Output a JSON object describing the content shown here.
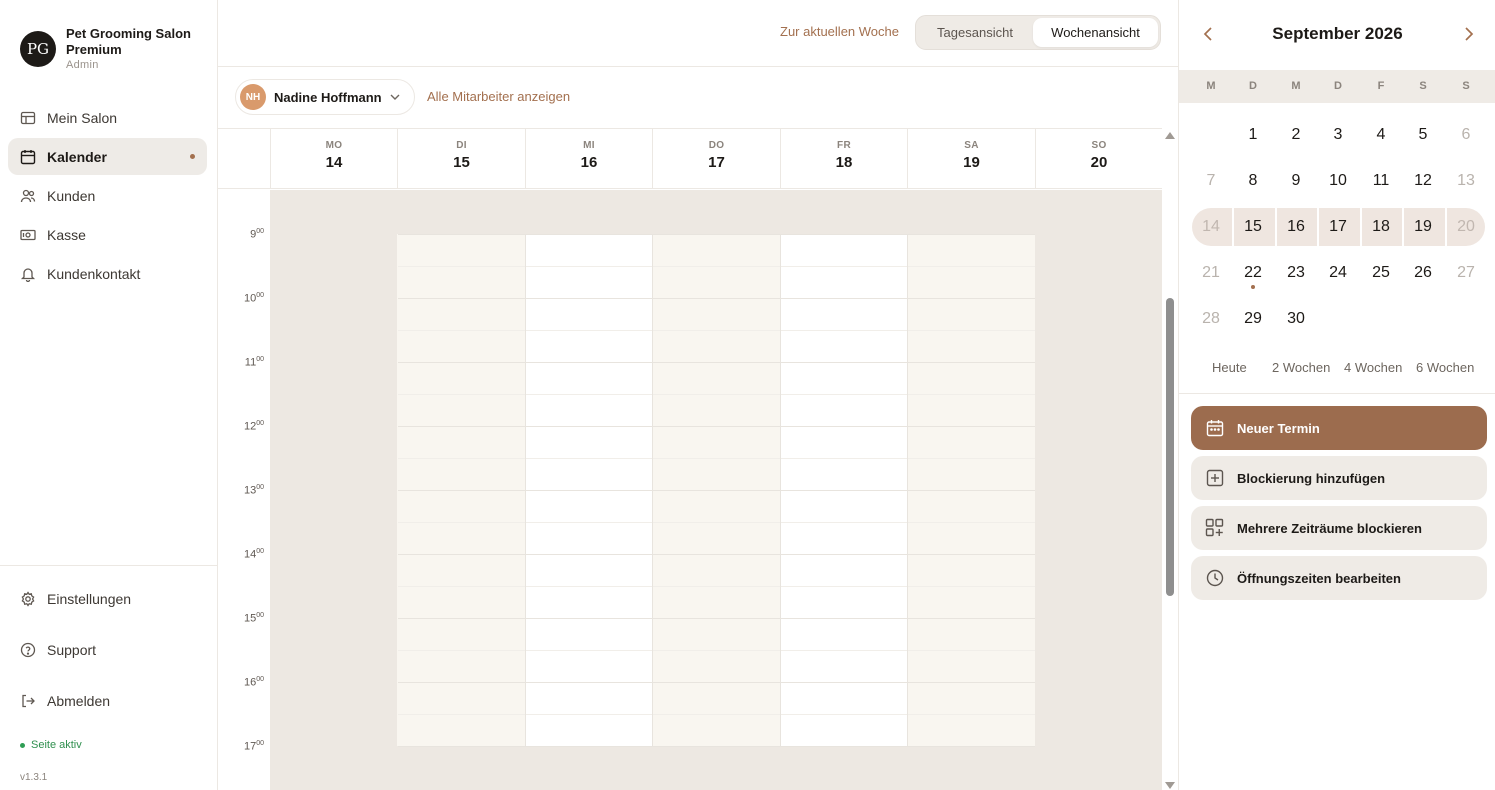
{
  "brand": {
    "logo": "PG",
    "name": "Pet Grooming Salon Premium",
    "role": "Admin"
  },
  "sidebar": {
    "items": [
      {
        "label": "Mein Salon",
        "icon": "storefront-icon"
      },
      {
        "label": "Kalender",
        "icon": "calendar-icon",
        "active": true
      },
      {
        "label": "Kunden",
        "icon": "users-icon"
      },
      {
        "label": "Kasse",
        "icon": "cash-register-icon"
      },
      {
        "label": "Kundenkontakt",
        "icon": "bell-icon"
      }
    ],
    "bottom": [
      {
        "label": "Einstellungen",
        "icon": "gear-icon"
      },
      {
        "label": "Support",
        "icon": "help-circle-icon"
      },
      {
        "label": "Abmelden",
        "icon": "logout-icon"
      }
    ],
    "status": "Seite aktiv",
    "version": "v1.3.1"
  },
  "toolbar": {
    "current_week": "Zur aktuellen Woche",
    "view_day": "Tagesansicht",
    "view_week": "Wochenansicht"
  },
  "staff": {
    "initials": "NH",
    "name": "Nadine Hoffmann",
    "show_all": "Alle Mitarbeiter anzeigen"
  },
  "week": {
    "days": [
      {
        "name": "MO",
        "date": "14"
      },
      {
        "name": "DI",
        "date": "15"
      },
      {
        "name": "MI",
        "date": "16"
      },
      {
        "name": "DO",
        "date": "17"
      },
      {
        "name": "FR",
        "date": "18"
      },
      {
        "name": "SA",
        "date": "19"
      },
      {
        "name": "SO",
        "date": "20"
      }
    ],
    "hours": [
      "9",
      "10",
      "11",
      "12",
      "13",
      "14",
      "15",
      "16",
      "17"
    ],
    "minutes": "00"
  },
  "mini_calendar": {
    "month": "September 2026",
    "weekdays": [
      "M",
      "D",
      "M",
      "D",
      "F",
      "S",
      "S"
    ],
    "weeks": [
      [
        "",
        "1",
        "2",
        "3",
        "4",
        "5",
        "6"
      ],
      [
        "7",
        "8",
        "9",
        "10",
        "11",
        "12",
        "13"
      ],
      [
        "14",
        "15",
        "16",
        "17",
        "18",
        "19",
        "20"
      ],
      [
        "21",
        "22",
        "23",
        "24",
        "25",
        "26",
        "27"
      ],
      [
        "28",
        "29",
        "30",
        "",
        "",
        "",
        ""
      ]
    ],
    "ranges": [
      "Heute",
      "2 Wochen",
      "4 Wochen",
      "6 Wochen"
    ]
  },
  "actions": [
    {
      "label": "Neuer Termin",
      "icon": "calendar-icon",
      "primary": true
    },
    {
      "label": "Blockierung hinzufügen",
      "icon": "plus-square-icon"
    },
    {
      "label": "Mehrere Zeiträume blockieren",
      "icon": "grid-plus-icon"
    },
    {
      "label": "Öffnungszeiten bearbeiten",
      "icon": "clock-icon"
    }
  ],
  "colors": {
    "accent": "#a3704f",
    "primary_button": "#9c6c4e",
    "status_green": "#2f9e55"
  }
}
